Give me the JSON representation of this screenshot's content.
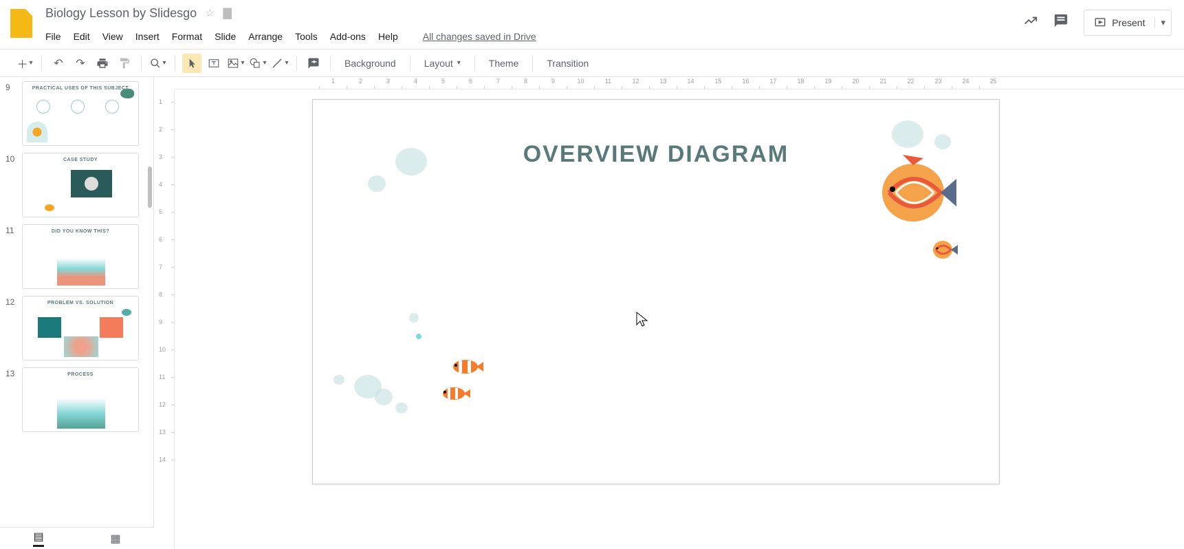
{
  "doc_title": "Biology Lesson by Slidesgo",
  "menus": [
    "File",
    "Edit",
    "View",
    "Insert",
    "Format",
    "Slide",
    "Arrange",
    "Tools",
    "Add-ons",
    "Help"
  ],
  "save_status": "All changes saved in Drive",
  "present_label": "Present",
  "toolbar": {
    "background": "Background",
    "layout": "Layout",
    "theme": "Theme",
    "transition": "Transition"
  },
  "thumbnails": [
    {
      "num": "9",
      "title": "PRACTICAL USES OF THIS SUBJECT"
    },
    {
      "num": "10",
      "title": "CASE STUDY"
    },
    {
      "num": "11",
      "title": "DID YOU KNOW THIS?"
    },
    {
      "num": "12",
      "title": "PROBLEM VS. SOLUTION"
    },
    {
      "num": "13",
      "title": "PROCESS"
    }
  ],
  "slide": {
    "title": "OVERVIEW DIAGRAM"
  },
  "ruler_h": [
    "1",
    "2",
    "3",
    "4",
    "5",
    "6",
    "7",
    "8",
    "9",
    "10",
    "11",
    "12",
    "13",
    "14",
    "15",
    "16",
    "17",
    "18",
    "19",
    "20",
    "21",
    "22",
    "23",
    "24",
    "25"
  ],
  "ruler_v": [
    "1",
    "2",
    "3",
    "4",
    "5",
    "6",
    "7",
    "8",
    "9",
    "10",
    "11",
    "12",
    "13",
    "14"
  ]
}
